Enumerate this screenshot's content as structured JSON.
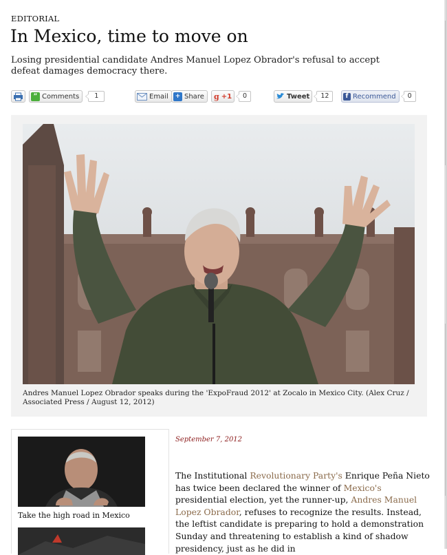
{
  "kicker": "EDITORIAL",
  "headline": "In Mexico, time to move on",
  "dek": "Losing presidential candidate Andres Manuel Lopez Obrador's refusal to accept defeat damages democracy there.",
  "toolbar": {
    "comments_label": "Comments",
    "comments_count": "1",
    "email_label": "Email",
    "share_label": "Share",
    "gplus_label": "+1",
    "gplus_count": "0",
    "tweet_label": "Tweet",
    "tweet_count": "12",
    "recommend_label": "Recommend",
    "recommend_count": "0"
  },
  "photo": {
    "caption": "Andres Manuel Lopez Obrador speaks during the 'ExpoFraud 2012' at Zocalo in Mexico City. (Alex Cruz / Associated Press / August 12, 2012)"
  },
  "related": {
    "caption": "Take the high road in Mexico"
  },
  "article": {
    "date": "September 7, 2012",
    "p1_a": "The Institutional ",
    "p1_link1": "Revolutionary Party's",
    "p1_b": " Enrique Peña Nieto has twice been declared the winner of ",
    "p1_link2": "Mexico's",
    "p1_c": " presidential election, yet the runner-up, ",
    "p1_link3": "Andres Manuel Lopez Obrador",
    "p1_d": ", refuses to recognize the results. Instead, the leftist candidate is preparing to hold a demonstration Sunday and threatening to establish a kind of shadow presidency, just as he did in"
  },
  "colors": {
    "date": "#8b1a1a",
    "link": "#8a6a4a",
    "twitter": "#2a8bd6",
    "facebook": "#3b5998",
    "gplus": "#d23a2a",
    "comments": "#4caf3c"
  }
}
